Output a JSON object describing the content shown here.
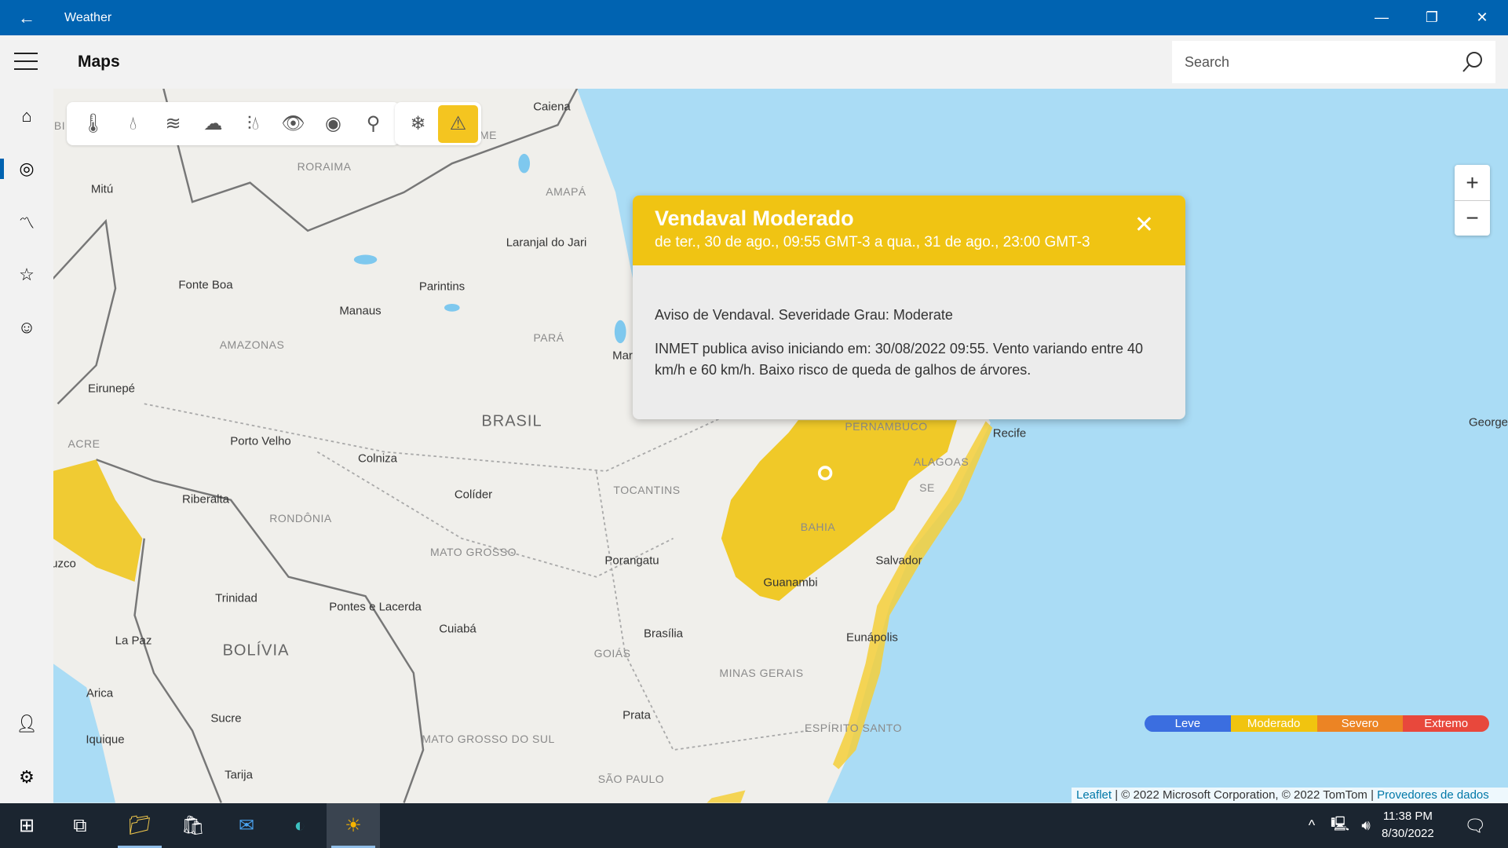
{
  "app": {
    "title": "Weather",
    "page_title": "Maps"
  },
  "search": {
    "placeholder": "Search"
  },
  "toolbar": {
    "layers": [
      "temperature-icon",
      "precipitation-icon",
      "wind-icon",
      "cloud-icon",
      "humidity-icon",
      "visibility-icon",
      "pressure-icon",
      "pollen-icon"
    ],
    "extra": [
      "snow-icon",
      "warning-icon"
    ],
    "active": "warning-icon",
    "accent": "#f4c520"
  },
  "map": {
    "labels": [
      "Caiena",
      "RORAIMA",
      "AMAPÁ",
      "Mitú",
      "Laranjal do Jari",
      "Fonte Boa",
      "Parintins",
      "Manaus",
      "AMAZONAS",
      "PARÁ",
      "Eirunepé",
      "BRASIL",
      "ACRE",
      "Porto Velho",
      "Colniza",
      "Recife",
      "PERNAMBUCO",
      "ALAGOAS",
      "SE",
      "Riberalta",
      "RONDÔNIA",
      "Colíder",
      "TOCANTINS",
      "BAHIA",
      "Salvador",
      "MATO GROSSO",
      "Porangatu",
      "Guanambi",
      "Trinidad",
      "Pontes e Lacerda",
      "Cuiabá",
      "Brasília",
      "Eunápolis",
      "La Paz",
      "BOLÍVIA",
      "GOIÁS",
      "MINAS GERAIS",
      "Arica",
      "Sucre",
      "Prata",
      "MATO GROSSO DO SUL",
      "ESPÍRITO SANTO",
      "Iquique",
      "Tarija",
      "SÃO PAULO",
      "George",
      "Mar",
      "uzco",
      "BI",
      "ME"
    ]
  },
  "popup": {
    "title": "Vendaval Moderado",
    "subtitle": "de ter., 30 de ago., 09:55 GMT-3 a qua., 31 de ago., 23:00 GMT-3",
    "line1": "Aviso de Vendaval. Severidade Grau: Moderate",
    "line2": "INMET publica aviso iniciando em: 30/08/2022 09:55. Vento variando entre 40 km/h e 60 km/h. Baixo risco de queda de galhos de árvores.",
    "color": "#f0c413"
  },
  "zoom": {
    "in": "+",
    "out": "−"
  },
  "legend": [
    {
      "label": "Leve",
      "color": "#3b6ee0"
    },
    {
      "label": "Moderado",
      "color": "#f1c40f"
    },
    {
      "label": "Severo",
      "color": "#ec8424"
    },
    {
      "label": "Extremo",
      "color": "#e8483c"
    }
  ],
  "attribution": {
    "leaflet": "Leaflet",
    "text": " | © 2022 Microsoft Corporation, © 2022 TomTom | ",
    "providers": "Provedores de dados"
  },
  "taskbar": {
    "time": "11:38 PM",
    "date": "8/30/2022"
  }
}
